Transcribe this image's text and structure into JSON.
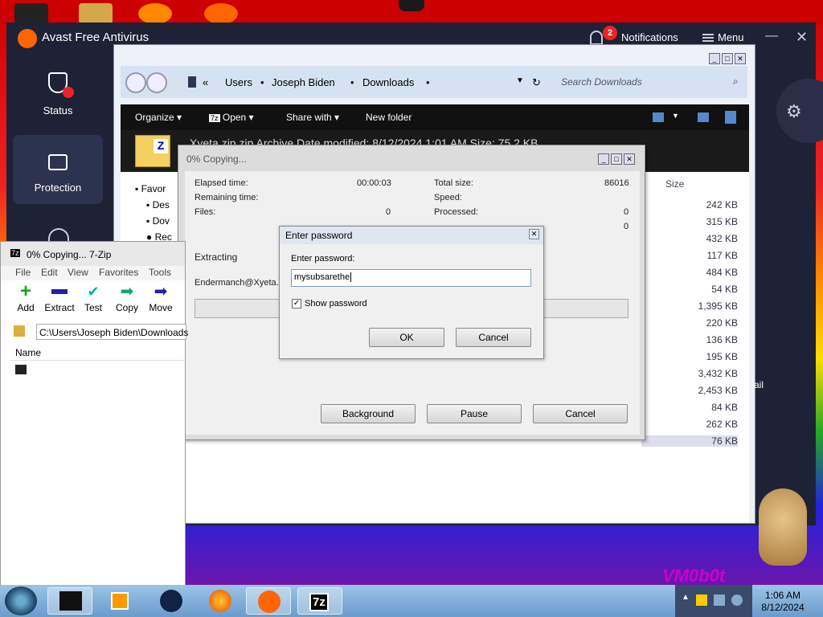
{
  "avast": {
    "title": "Avast Free Antivirus",
    "notifications_label": "Notifications",
    "notifications_count": "2",
    "menu_label": "Menu",
    "nav": [
      {
        "label": "Status"
      },
      {
        "label": "Protection"
      }
    ]
  },
  "explorer": {
    "breadcrumb": [
      "Users",
      "Joseph Biden",
      "Downloads"
    ],
    "search_placeholder": "Search Downloads",
    "commands": [
      "Organize",
      "Open",
      "Share with",
      "New folder"
    ],
    "info": "Xyeta.zip  zip Archive  Date modified: 8/12/2024 1:01 AM      Size: 75.2 KB",
    "tree": [
      "Favor",
      "Des",
      "Dov",
      "Rec"
    ],
    "size_header": "Size",
    "sizes": [
      "242 KB",
      "315 KB",
      "432 KB",
      "117 KB",
      "484 KB",
      "54 KB",
      "1,395 KB",
      "220 KB",
      "136 KB",
      "195 KB",
      "3,432 KB",
      "2,453 KB",
      "84 KB",
      "262 KB",
      "76 KB"
    ],
    "side_text": "ail"
  },
  "copying": {
    "title": "0% Copying...",
    "elapsed_label": "Elapsed time:",
    "elapsed": "00:00:03",
    "remaining_label": "Remaining time:",
    "files_label": "Files:",
    "files": "0",
    "total_label": "Total size:",
    "total": "86016",
    "speed_label": "Speed:",
    "processed_label": "Processed:",
    "processed": "0",
    "packed_value": "0",
    "extracting": "Extracting",
    "file": "Endermanch@Xyeta.e",
    "buttons": {
      "background": "Background",
      "pause": "Pause",
      "cancel": "Cancel"
    }
  },
  "password": {
    "title": "Enter password",
    "label": "Enter password:",
    "value": "mysubsarethe",
    "show_label": "Show password",
    "show_checked": "✓",
    "ok": "OK",
    "cancel": "Cancel"
  },
  "zip": {
    "title": "0% Copying... 7-Zip",
    "menu": [
      "File",
      "Edit",
      "View",
      "Favorites",
      "Tools"
    ],
    "tools": [
      "Add",
      "Extract",
      "Test",
      "Copy",
      "Move"
    ],
    "path": "C:\\Users\\Joseph Biden\\Downloads",
    "col_name": "Name"
  },
  "desktop": {
    "vm_text": "VM0b0t"
  },
  "taskbar": {
    "time": "1:06 AM",
    "date": "8/12/2024"
  }
}
